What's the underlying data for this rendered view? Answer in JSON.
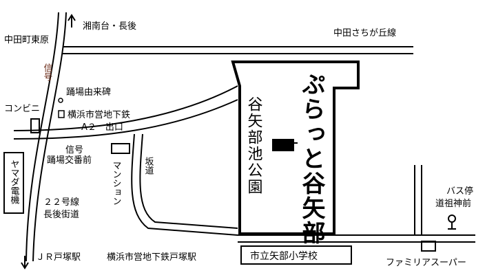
{
  "colors": {
    "line": "#000000",
    "signal_text": "#6b2a17",
    "background": "#ffffff"
  },
  "labels": {
    "shonandai": "湘南台・長後",
    "nakata_higashihara": "中田町東原",
    "nakata_sachigaoka": "中田さちが丘線",
    "shingo_top": "信号",
    "odoriba_yuraihi": "踊場由来碑",
    "conbini": "コンビニ",
    "subway_exit_line1": "横浜市営地下鉄",
    "subway_exit_line2": "A２　出口",
    "shingo_bottom": "信号",
    "odoriba_koban": "踊場交番前",
    "mansion": "マンション",
    "sakamichi": "坂道",
    "yamada_denki": "ヤマダ電機",
    "route22_line1": "２２号線",
    "route22_line2": "長後街道",
    "jr_totsuka": "ＪＲ戸塚駅",
    "subway_totsuka": "横浜市営地下鉄戸塚駅",
    "school": "市立矢部小学校",
    "bus_stop_line1": "バス停",
    "bus_stop_line2": "道祖神前",
    "family_mart": "ファミリアスーパー",
    "park": "谷矢部池公園",
    "facility": "ぷらっと谷矢部"
  }
}
